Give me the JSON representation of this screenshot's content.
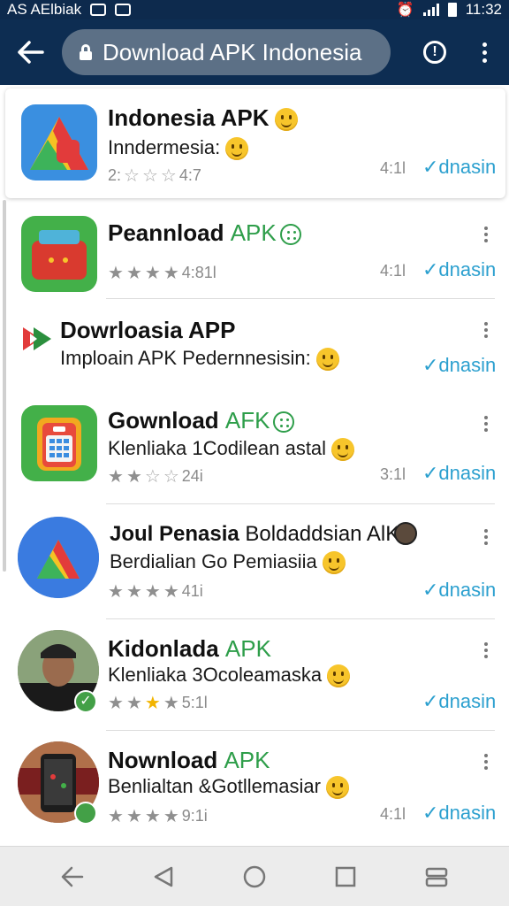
{
  "status_bar": {
    "left_text": "AS AElbiak",
    "time": "11:32"
  },
  "toolbar": {
    "url_text": "Download APK Indonesia",
    "back_icon": "back-arrow-icon",
    "search_icon": "search-icon",
    "menu_icon": "more-vert-icon"
  },
  "apps": [
    {
      "title": "Indonesia APK",
      "tag": "",
      "subtitle": "Inndermesia:",
      "rating_text": "2:",
      "rating_value": "4:7",
      "size": "4:1l",
      "link": "✓dnasin"
    },
    {
      "title": "Peannload",
      "tag": "APK",
      "subtitle": "",
      "rating_text": "",
      "rating_value": "4:81l",
      "size": "4:1l",
      "link": "✓dnasin"
    },
    {
      "title": "Dowrloasia APP",
      "tag": "",
      "subtitle": "Imploain APK Pedernnesisin:",
      "rating_text": "",
      "rating_value": "",
      "size": "",
      "link": "✓dnasin"
    },
    {
      "title": "Gownload",
      "tag": "AFK",
      "subtitle": "Klenliaka 1Codilean astal",
      "rating_text": "",
      "rating_value": "24i",
      "size": "3:1l",
      "link": "✓dnasin"
    },
    {
      "title": "Joul Penasia",
      "tag": "Boldaddsian AlK",
      "subtitle": "Berdialian Go Pemiasiia",
      "rating_text": "",
      "rating_value": "41i",
      "size": "",
      "link": "✓dnasin"
    },
    {
      "title": "Kidonlada",
      "tag": "APK",
      "subtitle": "Klenliaka 3Ocoleamaska",
      "rating_text": "",
      "rating_value": "5:1l",
      "size": "",
      "link": "✓dnasin"
    },
    {
      "title": "Nownload",
      "tag": "APK",
      "subtitle": "Benlialtan &Gotllemasiar",
      "rating_text": "",
      "rating_value": "9:1i",
      "size": "4:1l",
      "link": "✓dnasin"
    }
  ],
  "colors": {
    "toolbar": "#0d2d52",
    "accent_green": "#2e9e4a",
    "link_blue": "#2ca0cf"
  }
}
